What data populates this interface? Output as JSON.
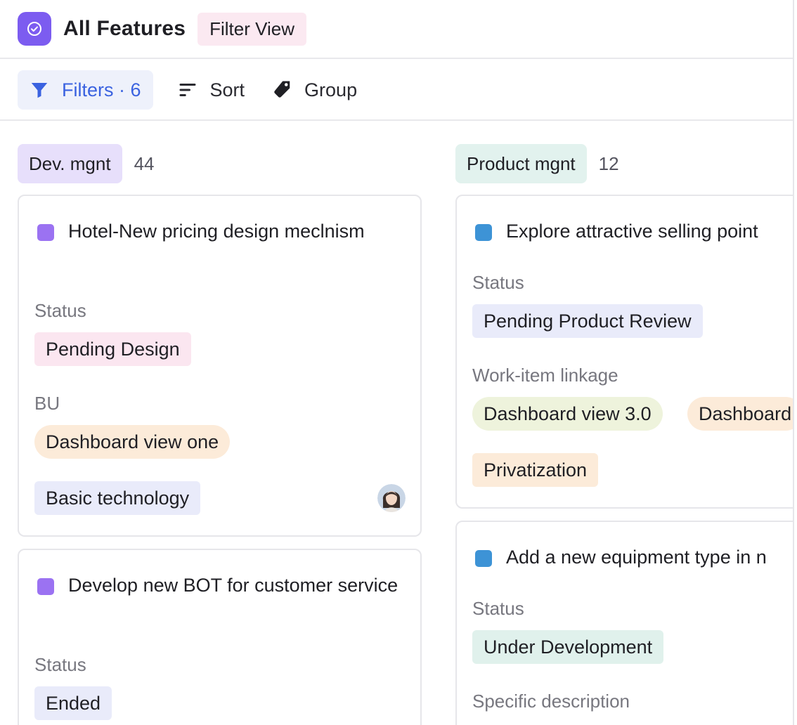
{
  "header": {
    "title": "All Features",
    "view_tag": "Filter View",
    "app_icon": "check-circle-icon"
  },
  "toolbar": {
    "filters_label": "Filters · 6",
    "sort_label": "Sort",
    "group_label": "Group"
  },
  "colors": {
    "accent": "#3a62e0",
    "app_icon_bg": "#7c5cf0",
    "purple_dot": "#9b72f2",
    "blue_dot": "#3d93d6"
  },
  "columns": [
    {
      "name": "Dev. mgnt",
      "count": "44",
      "tag_color": "#e7dffb",
      "cards": [
        {
          "title": "Hotel-New pricing design meclnism",
          "status_label": "Status",
          "status": "Pending Design",
          "bu_label": "BU",
          "bu": "Dashboard view one",
          "tag": "Basic technology"
        },
        {
          "title": "Develop new BOT for customer service",
          "status_label": "Status",
          "status": "Ended"
        }
      ]
    },
    {
      "name": "Product mgnt",
      "count": "12",
      "tag_color": "#e2f2ee",
      "cards": [
        {
          "title": "Explore attractive selling point",
          "status_label": "Status",
          "status": "Pending Product Review",
          "linkage_label": "Work-item linkage",
          "linkages": [
            "Dashboard view 3.0",
            "Dashboard",
            "Privatization"
          ]
        },
        {
          "title": "Add a new equipment type in n",
          "status_label": "Status",
          "status": "Under Development",
          "desc_label": "Specific description"
        }
      ]
    }
  ]
}
